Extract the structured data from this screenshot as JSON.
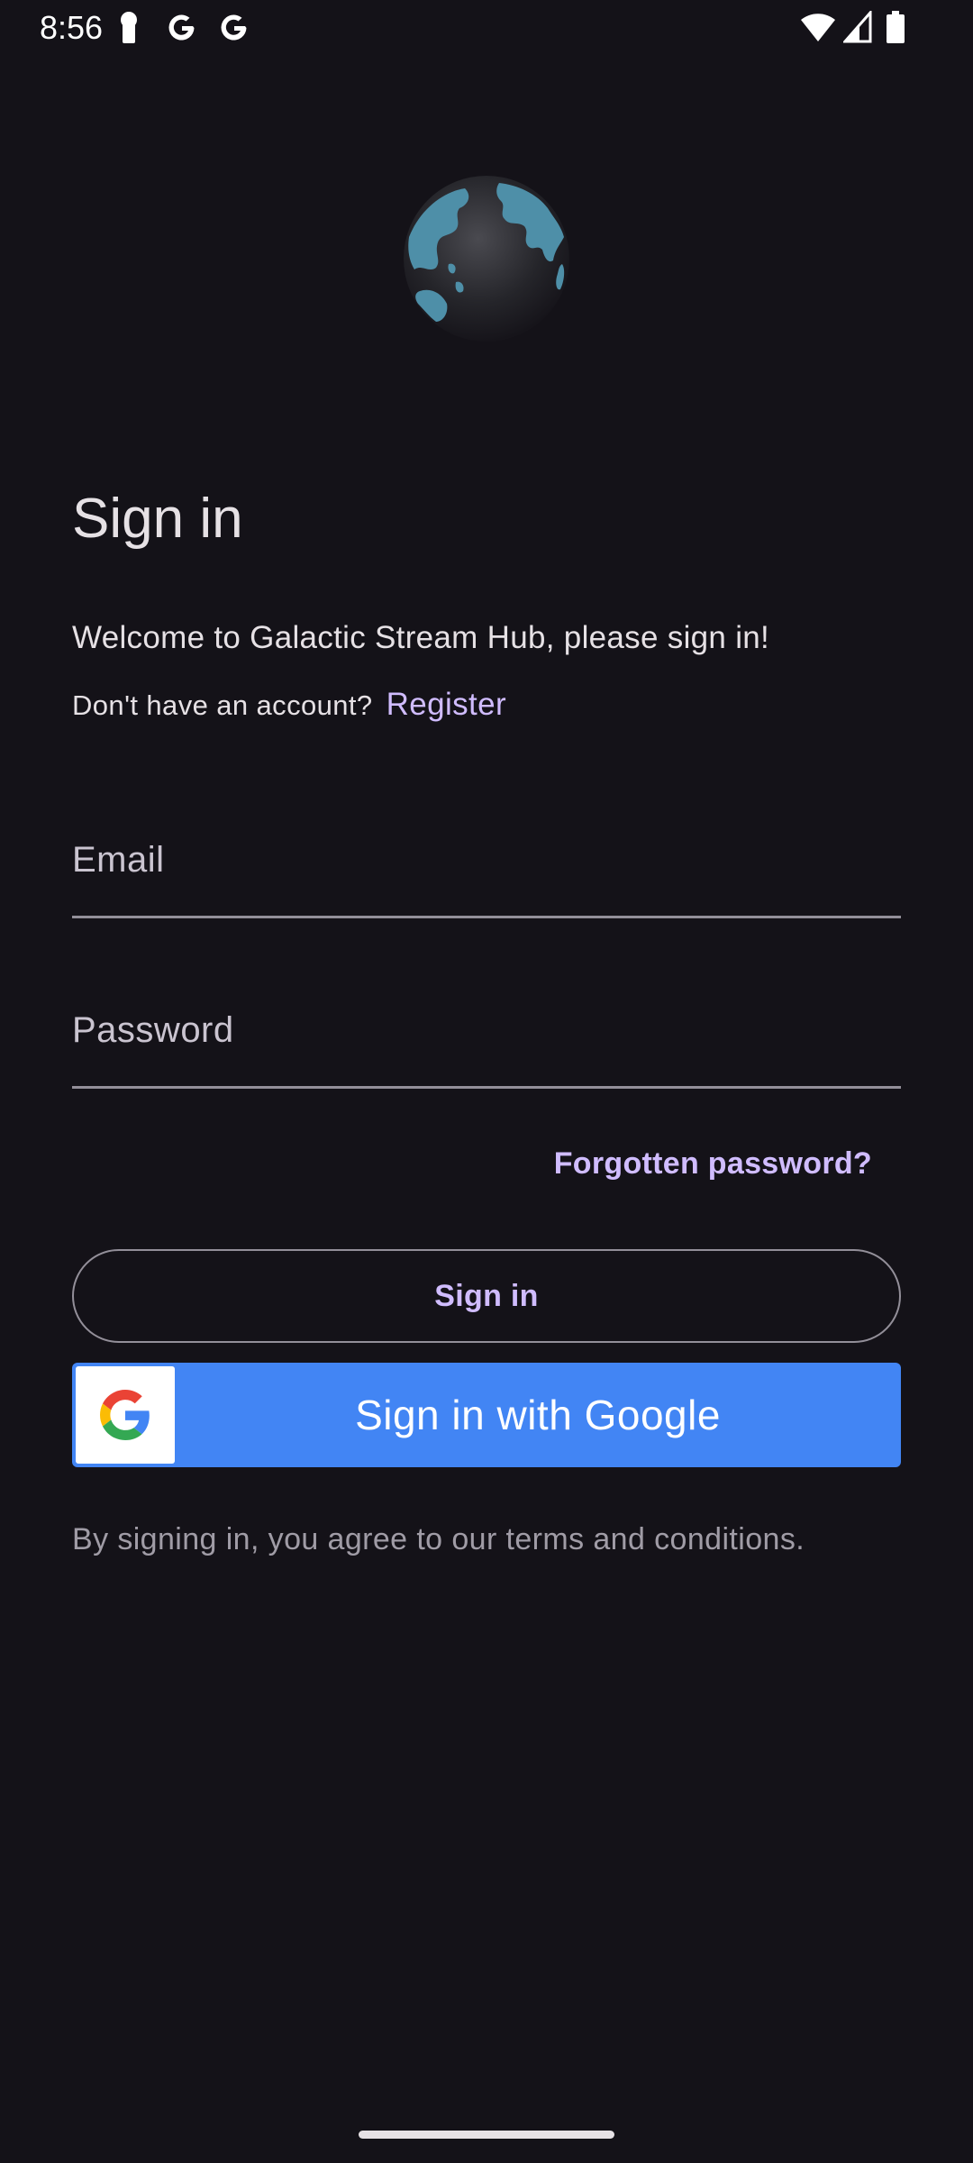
{
  "status_bar": {
    "time": "8:56",
    "icons": [
      "key-icon",
      "google-icon",
      "google-icon",
      "wifi-icon",
      "signal-icon",
      "battery-icon"
    ]
  },
  "logo": {
    "icon": "globe-icon"
  },
  "signin": {
    "title": "Sign in",
    "welcome": "Welcome to Galactic Stream Hub, please sign in!",
    "no_account_text": "Don't have an account?",
    "register_label": "Register",
    "email_label": "Email",
    "email_value": "",
    "password_label": "Password",
    "password_value": "",
    "forgot_label": "Forgotten password?",
    "signin_button_label": "Sign in",
    "google_button_label": "Sign in with Google",
    "terms_text": "By signing in, you agree to our terms and conditions."
  },
  "colors": {
    "background": "#141218",
    "accent": "#d0bcff",
    "google_blue": "#4285f4",
    "divider": "#938f99"
  }
}
